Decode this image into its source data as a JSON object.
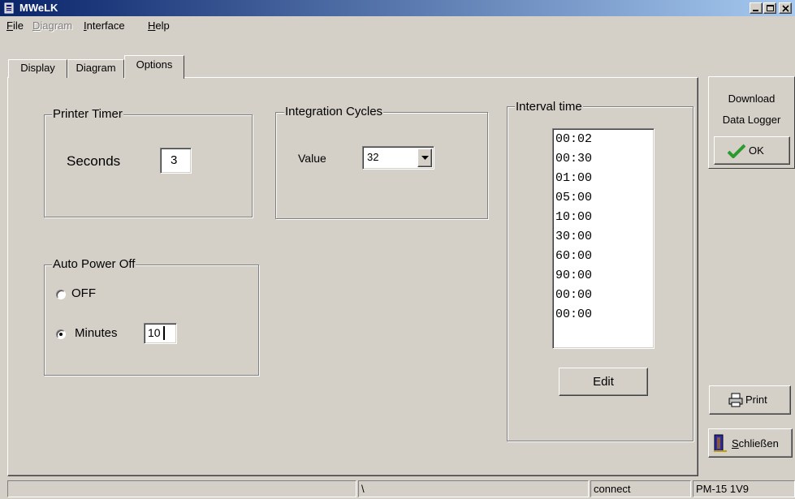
{
  "window": {
    "title": "MWeLK",
    "colors": {
      "titlebar_start": "#0a246a",
      "titlebar_end": "#a6caf0",
      "face": "#d4d0c8",
      "ok_check": "#2c9a2c"
    }
  },
  "menu": [
    {
      "label": "File",
      "accel": "F",
      "rest": "ile",
      "enabled": true
    },
    {
      "label": "Diagram",
      "accel": "D",
      "rest": "iagram",
      "enabled": false
    },
    {
      "label": "Interface",
      "accel": "I",
      "rest": "nterface",
      "enabled": true
    },
    {
      "label": "Help",
      "accel": "H",
      "rest": "elp",
      "enabled": true
    }
  ],
  "tabs": [
    {
      "label": "Display",
      "active": false
    },
    {
      "label": "Diagram",
      "active": false
    },
    {
      "label": "Options",
      "active": true
    }
  ],
  "printer_timer": {
    "title": "Printer Timer",
    "label": "Seconds",
    "value": "3"
  },
  "integration": {
    "title": "Integration Cycles",
    "label": "Value",
    "selected": "32"
  },
  "auto_power": {
    "title": "Auto Power Off",
    "off_label": "OFF",
    "minutes_label": "Minutes",
    "minutes_value": "10",
    "selected": "minutes"
  },
  "interval": {
    "title": "Interval time",
    "items": [
      "00:02",
      "00:30",
      "01:00",
      "05:00",
      "10:00",
      "30:00",
      "60:00",
      "90:00",
      "00:00",
      "00:00"
    ],
    "edit_label": "Edit"
  },
  "download": {
    "line1": "Download",
    "line2": "Data Logger",
    "ok_label": "OK"
  },
  "buttons": {
    "print": "Print",
    "close_accel": "S",
    "close_rest": "chließen"
  },
  "status": {
    "cell2": "\\",
    "cell3": "connect",
    "cell4": "PM-15  1V9"
  }
}
